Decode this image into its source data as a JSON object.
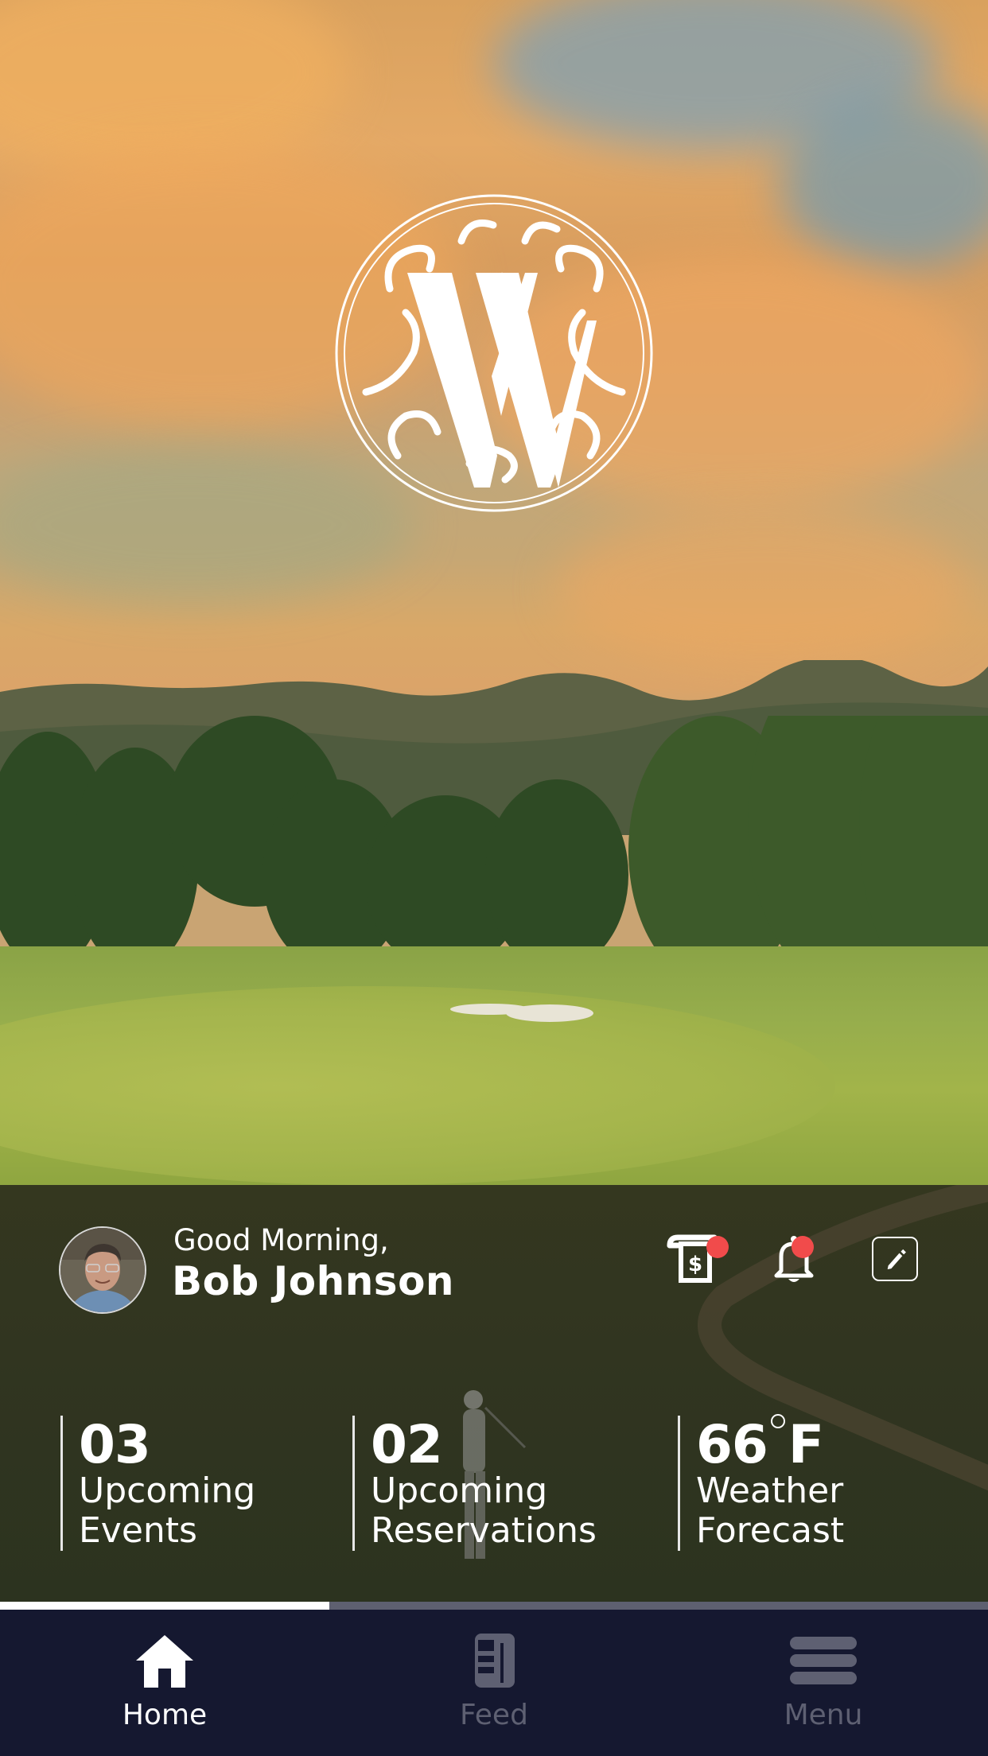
{
  "app": {
    "logo_letter": "W",
    "logo_name": "club-monogram-logo"
  },
  "greeting": {
    "salutation": "Good Morning,",
    "name": "Bob Johnson"
  },
  "header_actions": [
    {
      "name": "billing-statement",
      "icon": "receipt-dollar-icon",
      "has_badge": true
    },
    {
      "name": "notifications",
      "icon": "bell-icon",
      "has_badge": true
    },
    {
      "name": "edit-profile",
      "icon": "pencil-icon",
      "has_badge": false
    }
  ],
  "stats": [
    {
      "value": "03",
      "label_line1": "Upcoming",
      "label_line2": "Events"
    },
    {
      "value": "02",
      "label_line1": "Upcoming",
      "label_line2": "Reservations"
    },
    {
      "value": "66",
      "unit": "F",
      "label_line1": "Weather",
      "label_line2": "Forecast"
    }
  ],
  "progress": {
    "fraction": 0.333
  },
  "nav": {
    "items": [
      {
        "label": "Home",
        "icon": "home-icon",
        "active": true
      },
      {
        "label": "Feed",
        "icon": "newspaper-icon",
        "active": false
      },
      {
        "label": "Menu",
        "icon": "hamburger-menu-icon",
        "active": false
      }
    ]
  },
  "colors": {
    "badge": "#f14b4b",
    "nav_bg": "#151830",
    "nav_inactive": "#5e6072",
    "nav_active": "#ffffff",
    "progress_track": "#5e6070"
  }
}
